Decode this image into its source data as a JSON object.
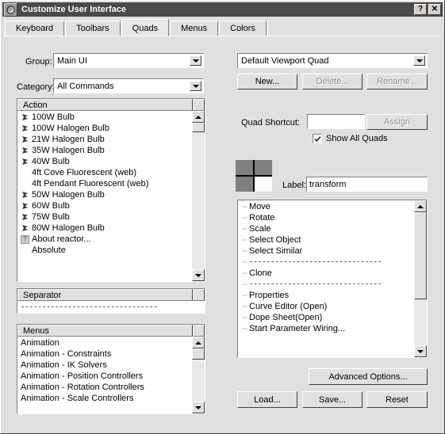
{
  "window": {
    "title": "Customize User Interface",
    "icon": "max-swirl-icon",
    "help_button": "?",
    "close_button": "✕"
  },
  "tabs": [
    {
      "label": "Keyboard",
      "active": false
    },
    {
      "label": "Toolbars",
      "active": false
    },
    {
      "label": "Quads",
      "active": true
    },
    {
      "label": "Menus",
      "active": false
    },
    {
      "label": "Colors",
      "active": false
    }
  ],
  "left": {
    "group_label": "Group:",
    "group_value": "Main UI",
    "category_label": "Category:",
    "category_value": "All Commands",
    "action_header": "Action",
    "actions": [
      {
        "label": "100W Bulb",
        "icon": "bulb-icon"
      },
      {
        "label": "100W Halogen Bulb",
        "icon": "bulb-icon"
      },
      {
        "label": "21W Halogen Bulb",
        "icon": "bulb-icon"
      },
      {
        "label": "35W Halogen Bulb",
        "icon": "bulb-icon"
      },
      {
        "label": "40W Bulb",
        "icon": "bulb-icon"
      },
      {
        "label": "4ft Cove Fluorescent (web)",
        "icon": "none"
      },
      {
        "label": "4ft Pendant Fluorescent (web)",
        "icon": "none"
      },
      {
        "label": "50W Halogen Bulb",
        "icon": "bulb-icon"
      },
      {
        "label": "60W Bulb",
        "icon": "bulb-icon"
      },
      {
        "label": "75W Bulb",
        "icon": "bulb-icon"
      },
      {
        "label": "80W Halogen Bulb",
        "icon": "bulb-icon"
      },
      {
        "label": "About reactor...",
        "icon": "question-icon"
      },
      {
        "label": "Absolute",
        "icon": "none"
      }
    ],
    "separator_header": "Separator",
    "separator_row": "--------------------------------",
    "menus_header": "Menus",
    "menus": [
      "Animation",
      "Animation - Constraints",
      "Animation - IK Solvers",
      "Animation - Position Controllers",
      "Animation - Rotation Controllers",
      "Animation - Scale Controllers"
    ]
  },
  "right": {
    "quad_set_value": "Default Viewport Quad",
    "new_button": "New...",
    "delete_button": "Delete...",
    "rename_button": "Rename...",
    "quad_shortcut_label": "Quad Shortcut:",
    "quad_shortcut_value": "",
    "show_all_quads_label": "Show All Quads",
    "show_all_quads_checked": true,
    "quad_cells": [
      {
        "name": "upper-left",
        "selected": false
      },
      {
        "name": "upper-right",
        "selected": false
      },
      {
        "name": "lower-left",
        "selected": false
      },
      {
        "name": "lower-right",
        "selected": true
      }
    ],
    "label_label": "Label:",
    "label_value": "transform",
    "menu_items": [
      {
        "label": "Move",
        "type": "item"
      },
      {
        "label": "Rotate",
        "type": "item"
      },
      {
        "label": "Scale",
        "type": "item"
      },
      {
        "label": "Select Object",
        "type": "item"
      },
      {
        "label": "Select Similar",
        "type": "item"
      },
      {
        "label": "-------------------------------",
        "type": "separator"
      },
      {
        "label": "Clone",
        "type": "item"
      },
      {
        "label": "-------------------------------",
        "type": "separator"
      },
      {
        "label": "Properties",
        "type": "item"
      },
      {
        "label": "Curve Editor (Open)",
        "type": "item"
      },
      {
        "label": "Dope Sheet(Open)",
        "type": "item"
      },
      {
        "label": "Start Parameter Wiring...",
        "type": "item"
      }
    ],
    "advanced_options_button": "Advanced Options...",
    "load_button": "Load...",
    "save_button": "Save...",
    "reset_button": "Reset"
  },
  "colors": {
    "dialog_face": "#e0e0e0",
    "titlebar": "#4a4a4a",
    "quad_cell": "#808080",
    "quad_cell_selected": "#fafafa",
    "disabled_text": "#909090"
  }
}
